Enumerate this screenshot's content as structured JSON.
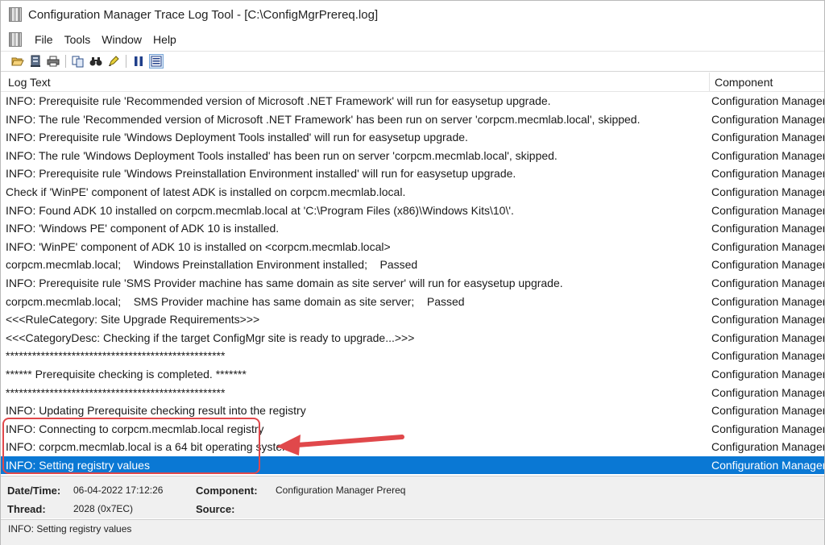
{
  "window": {
    "title": "Configuration Manager Trace Log Tool - [C:\\ConfigMgrPrereq.log]"
  },
  "menu": {
    "items": [
      "File",
      "Tools",
      "Window",
      "Help"
    ]
  },
  "toolbar": {
    "icons": [
      "open-folder-icon",
      "server-icon",
      "printer-icon",
      "copy-icon",
      "find-binoculars-icon",
      "highlight-pen-icon",
      "pause-icon",
      "detail-pane-icon"
    ]
  },
  "columns": {
    "log_text": "Log Text",
    "component": "Component"
  },
  "rows": [
    {
      "text": "INFO: Prerequisite rule 'Recommended version of Microsoft .NET Framework' will run for easysetup upgrade.",
      "component": "Configuration Manager Prereq"
    },
    {
      "text": "INFO: The rule 'Recommended version of Microsoft .NET Framework' has been run on server 'corpcm.mecmlab.local', skipped.",
      "component": "Configuration Manager Prereq"
    },
    {
      "text": "INFO: Prerequisite rule 'Windows Deployment Tools installed' will run for easysetup upgrade.",
      "component": "Configuration Manager Prereq"
    },
    {
      "text": "INFO: The rule 'Windows Deployment Tools installed' has been run on server 'corpcm.mecmlab.local', skipped.",
      "component": "Configuration Manager Prereq"
    },
    {
      "text": "INFO: Prerequisite rule 'Windows Preinstallation Environment installed' will run for easysetup upgrade.",
      "component": "Configuration Manager Prereq"
    },
    {
      "text": "Check if 'WinPE' component of latest ADK is installed on corpcm.mecmlab.local.",
      "component": "Configuration Manager Prereq"
    },
    {
      "text": "INFO: Found ADK 10 installed on corpcm.mecmlab.local at 'C:\\Program Files (x86)\\Windows Kits\\10\\'.",
      "component": "Configuration Manager Prereq"
    },
    {
      "text": "INFO: 'Windows PE' component of ADK 10 is installed.",
      "component": "Configuration Manager Prereq"
    },
    {
      "text": "INFO: 'WinPE' component of ADK 10 is installed on <corpcm.mecmlab.local>",
      "component": "Configuration Manager Prereq"
    },
    {
      "text": "corpcm.mecmlab.local;    Windows Preinstallation Environment installed;    Passed",
      "component": "Configuration Manager Prereq"
    },
    {
      "text": "INFO: Prerequisite rule 'SMS Provider machine has same domain as site server' will run for easysetup upgrade.",
      "component": "Configuration Manager Prereq"
    },
    {
      "text": "corpcm.mecmlab.local;    SMS Provider machine has same domain as site server;    Passed",
      "component": "Configuration Manager Prereq"
    },
    {
      "text": "<<<RuleCategory: Site Upgrade Requirements>>>",
      "component": "Configuration Manager Prereq"
    },
    {
      "text": "<<<CategoryDesc: Checking if the target ConfigMgr site is ready to upgrade...>>>",
      "component": "Configuration Manager Prereq"
    },
    {
      "text": "**************************************************",
      "component": "Configuration Manager Prereq"
    },
    {
      "text": "****** Prerequisite checking is completed. *******",
      "component": "Configuration Manager Prereq"
    },
    {
      "text": "**************************************************",
      "component": "Configuration Manager Prereq"
    },
    {
      "text": "INFO: Updating Prerequisite checking result into the registry",
      "component": "Configuration Manager Prereq"
    },
    {
      "text": "INFO: Connecting to corpcm.mecmlab.local registry",
      "component": "Configuration Manager Prereq"
    },
    {
      "text": "INFO: corpcm.mecmlab.local is a 64 bit operating system.",
      "component": "Configuration Manager Prereq"
    },
    {
      "text": "INFO: Setting registry values",
      "component": "Configuration Manager Prereq",
      "selected": true
    }
  ],
  "details": {
    "datetime_label": "Date/Time:",
    "datetime_value": "06-04-2022 17:12:26",
    "component_label": "Component:",
    "component_value": "Configuration Manager Prereq",
    "thread_label": "Thread:",
    "thread_value": "2028 (0x7EC)",
    "source_label": "Source:",
    "source_value": ""
  },
  "message": "INFO: Setting registry values",
  "colors": {
    "selection": "#0a78d4",
    "annotation": "#e0484b"
  }
}
